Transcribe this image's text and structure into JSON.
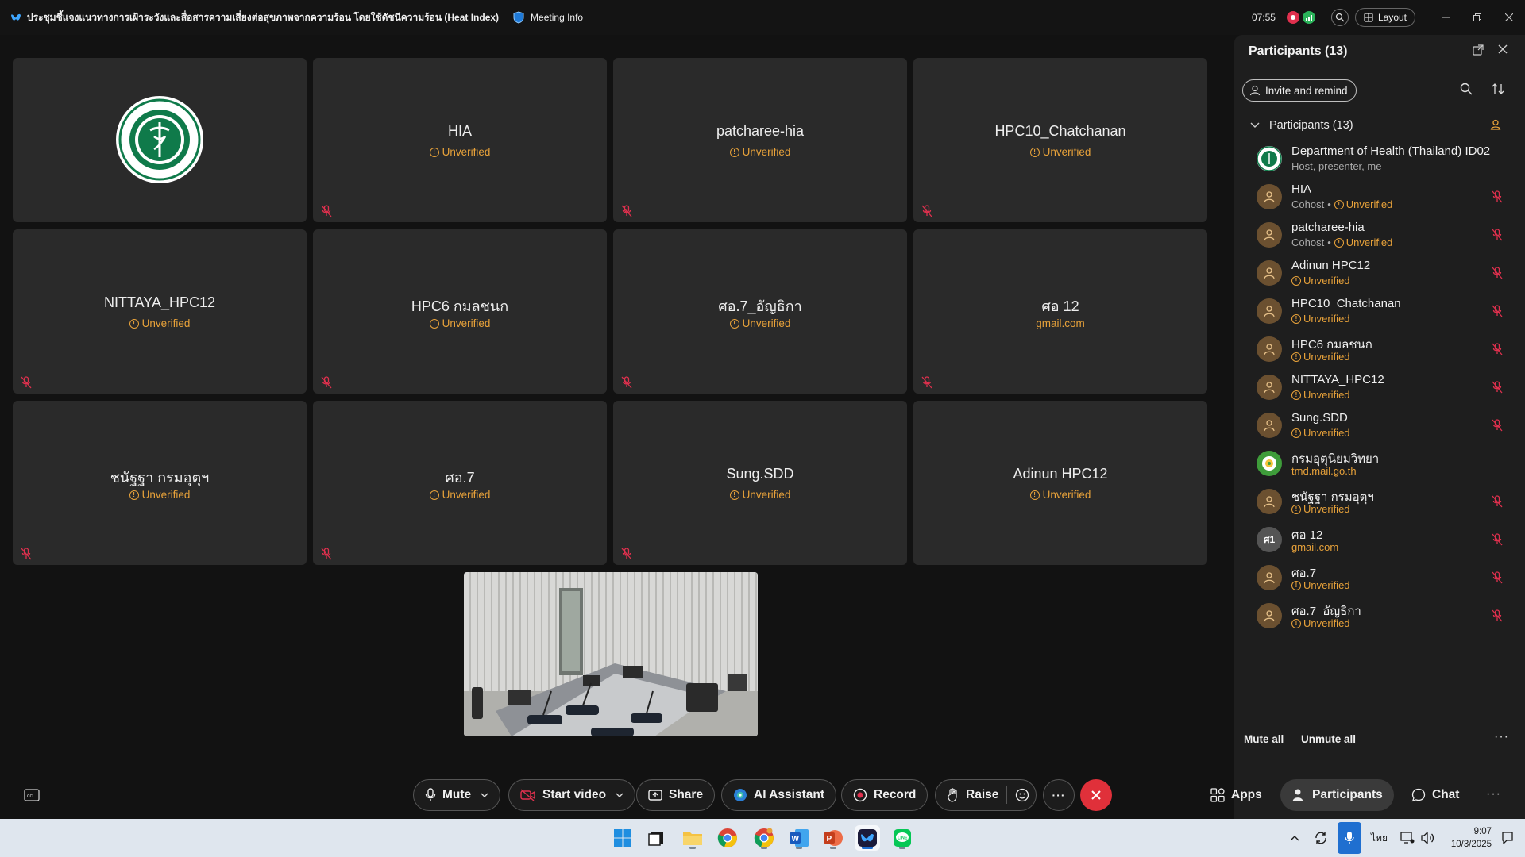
{
  "window": {
    "title": "ประชุมชี้แจงแนวทางการเฝ้าระวังและสื่อสารความเสี่ยงต่อสุขภาพจากความร้อน โดยใช้ดัชนีความร้อน (Heat Index)",
    "meeting_info_label": "Meeting Info",
    "elapsed": "07:55",
    "layout_label": "Layout"
  },
  "video_tiles": [
    {
      "name": "",
      "sub": "",
      "logo": true
    },
    {
      "name": "HIA",
      "sub": "Unverified"
    },
    {
      "name": "patcharee-hia",
      "sub": "Unverified"
    },
    {
      "name": "HPC10_Chatchanan",
      "sub": "Unverified"
    },
    {
      "name": "NITTAYA_HPC12",
      "sub": "Unverified"
    },
    {
      "name": "HPC6 กมลชนก",
      "sub": "Unverified"
    },
    {
      "name": "ศอ.7_อัญธิกา",
      "sub": "Unverified"
    },
    {
      "name": "ศอ 12",
      "sub": "gmail.com"
    },
    {
      "name": "ชนัฐฐา กรมอุตุฯ",
      "sub": "Unverified"
    },
    {
      "name": "ศอ.7",
      "sub": "Unverified"
    },
    {
      "name": "Sung.SDD",
      "sub": "Unverified"
    },
    {
      "name": "Adinun HPC12",
      "sub": "Unverified"
    }
  ],
  "logo_text": "MINISTRY OF PUBLIC HEALTH",
  "participants_panel": {
    "title": "Participants (13)",
    "invite_label": "Invite and remind",
    "section_label": "Participants (13)",
    "mute_all": "Mute all",
    "unmute_all": "Unmute all",
    "items": [
      {
        "name": "Department of Health (Thailand) ID02",
        "role": "Host, presenter, me",
        "status": "",
        "avatar": "logo"
      },
      {
        "name": "HIA",
        "role": "Cohost",
        "status": "Unverified",
        "avatar": "person"
      },
      {
        "name": "patcharee-hia",
        "role": "Cohost",
        "status": "Unverified",
        "avatar": "person"
      },
      {
        "name": "Adinun HPC12",
        "role": "",
        "status": "Unverified",
        "avatar": "person"
      },
      {
        "name": "HPC10_Chatchanan",
        "role": "",
        "status": "Unverified",
        "avatar": "person"
      },
      {
        "name": "HPC6 กมลชนก",
        "role": "",
        "status": "Unverified",
        "avatar": "person"
      },
      {
        "name": "NITTAYA_HPC12",
        "role": "",
        "status": "Unverified",
        "avatar": "person"
      },
      {
        "name": "Sung.SDD",
        "role": "",
        "status": "Unverified",
        "avatar": "person"
      },
      {
        "name": "กรมอุตุนิยมวิทยา",
        "role": "",
        "status": "tmd.mail.go.th",
        "avatar": "green"
      },
      {
        "name": "ชนัฐฐา กรมอุตุฯ",
        "role": "",
        "status": "Unverified",
        "avatar": "person"
      },
      {
        "name": "ศอ 12",
        "role": "",
        "status": "gmail.com",
        "avatar": "initials",
        "initials": "ศ1"
      },
      {
        "name": "ศอ.7",
        "role": "",
        "status": "Unverified",
        "avatar": "person"
      },
      {
        "name": "ศอ.7_อัญธิกา",
        "role": "",
        "status": "Unverified",
        "avatar": "person"
      }
    ]
  },
  "controls": {
    "mute": "Mute",
    "start_video": "Start video",
    "share": "Share",
    "ai_assistant": "AI Assistant",
    "record": "Record",
    "raise": "Raise",
    "apps": "Apps",
    "participants": "Participants",
    "chat": "Chat"
  },
  "taskbar": {
    "lang": "ไทย",
    "time": "9:07",
    "date": "10/3/2025"
  },
  "colors": {
    "accent_orange": "#e8a23a",
    "mute_red": "#e0304e",
    "end_red": "#e0303a"
  }
}
